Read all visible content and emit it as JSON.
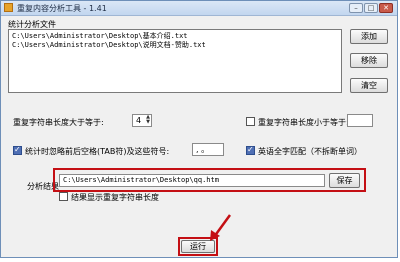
{
  "window": {
    "title": "重复内容分析工具 - 1.41",
    "controls": {
      "minimize": "–",
      "maximize": "□",
      "close": "✕"
    }
  },
  "files": {
    "group_label": "统计分析文件",
    "items": [
      "C:\\Users\\Administrator\\Desktop\\基本介绍.txt",
      "C:\\Users\\Administrator\\Desktop\\说明文档-赞助.txt"
    ],
    "add_label": "添加",
    "remove_label": "移除",
    "clear_label": "清空"
  },
  "options": {
    "min_length_label": "重复字符串长度大于等于:",
    "min_length_value": "4",
    "max_length_label": "重复字符串长度小于等于:",
    "max_length_value": "",
    "max_length_checked": false,
    "ignore_label": "统计时忽略前后空格(TAB符)及这些符号:",
    "ignore_value": ", 。",
    "ignore_checked": true,
    "whole_word_label": "英语全字匹配（不拆断单词）",
    "whole_word_checked": true
  },
  "result": {
    "label": "分析结果",
    "path": "C:\\Users\\Administrator\\Desktop\\qq.htm",
    "save_label": "保存",
    "show_length_label": "结果显示重复字符串长度",
    "show_length_checked": false
  },
  "run_label": "运行",
  "colors": {
    "highlight": "#c40f14",
    "accent": "#4f6fb4"
  }
}
